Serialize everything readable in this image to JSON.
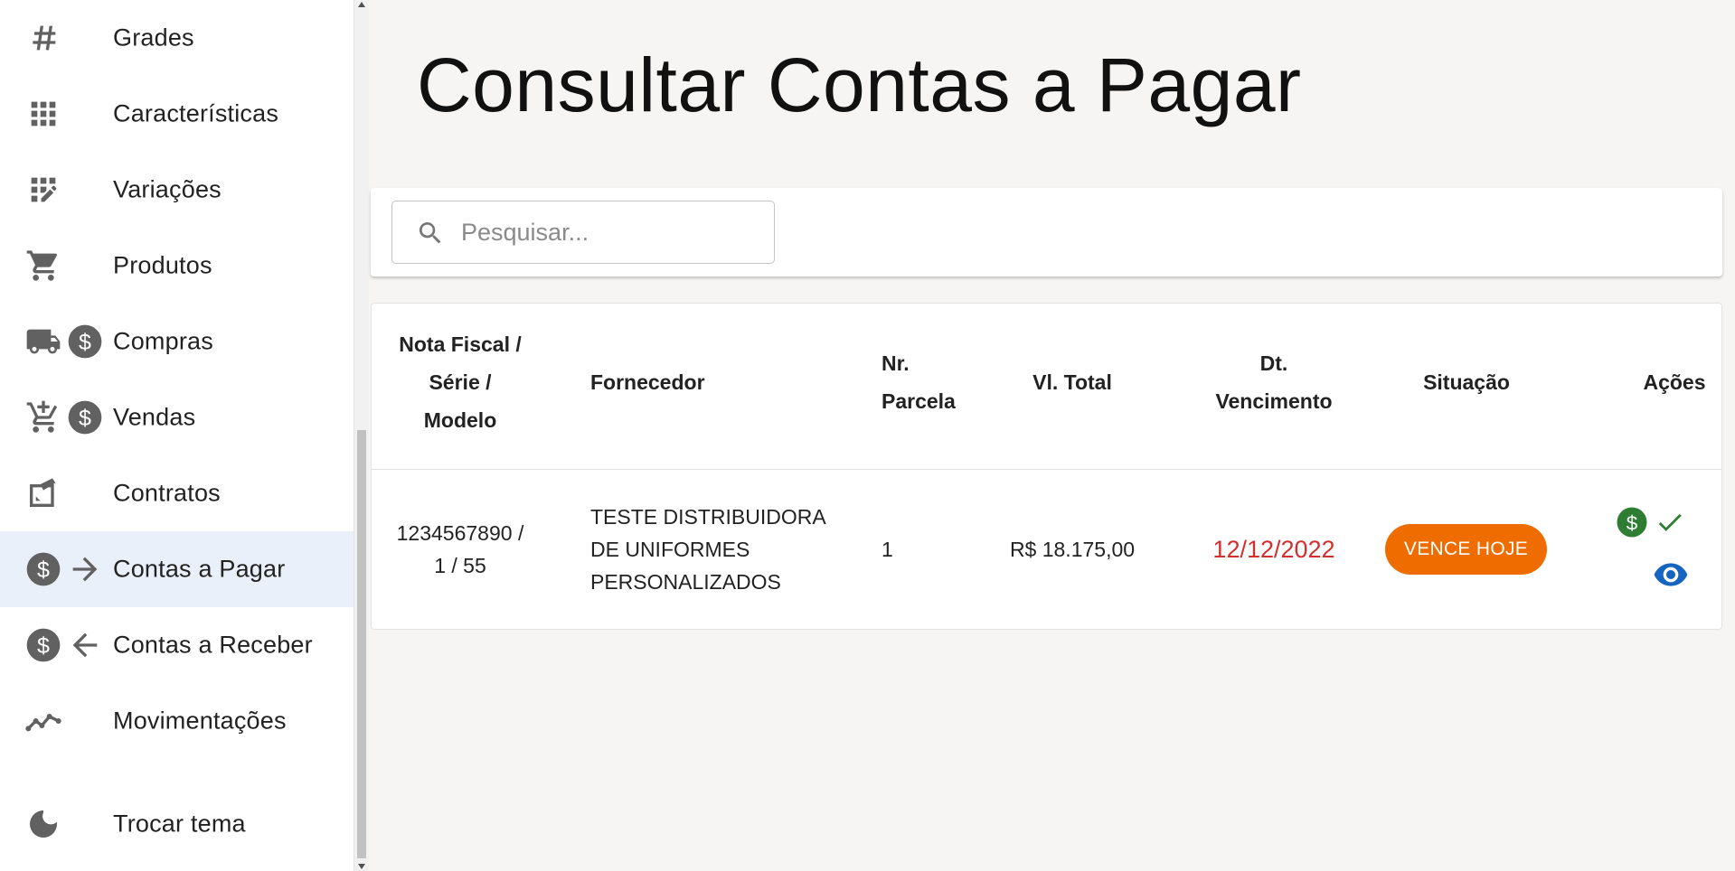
{
  "sidebar": {
    "items": [
      {
        "label": "Grades",
        "icon": "hash-icon"
      },
      {
        "label": "Características",
        "icon": "grid-icon"
      },
      {
        "label": "Variações",
        "icon": "grid-edit-icon"
      },
      {
        "label": "Produtos",
        "icon": "cart-icon"
      },
      {
        "label": "Compras",
        "icon": "truck-dollar-icon"
      },
      {
        "label": "Vendas",
        "icon": "cart-plus-dollar-icon"
      },
      {
        "label": "Contratos",
        "icon": "contract-icon"
      },
      {
        "label": "Contas a Pagar",
        "icon": "dollar-arrow-right-icon",
        "active": true
      },
      {
        "label": "Contas a Receber",
        "icon": "dollar-arrow-left-icon"
      },
      {
        "label": "Movimentações",
        "icon": "trend-line-icon"
      }
    ],
    "theme_toggle": {
      "label": "Trocar tema",
      "icon": "moon-icon"
    }
  },
  "main": {
    "title": "Consultar Contas a Pagar",
    "search": {
      "placeholder": "Pesquisar...",
      "value": ""
    },
    "table": {
      "headers": {
        "nota_fiscal": [
          "Nota Fiscal /",
          "Série /",
          "Modelo"
        ],
        "fornecedor": "Fornecedor",
        "parcela": [
          "Nr.",
          "Parcela"
        ],
        "valor_total": "Vl. Total",
        "vencimento": [
          "Dt.",
          "Vencimento"
        ],
        "situacao": "Situação",
        "acoes": "Ações"
      },
      "rows": [
        {
          "nota_fiscal": [
            "1234567890 /",
            "1 / 55"
          ],
          "fornecedor": [
            "TESTE DISTRIBUIDORA",
            "DE UNIFORMES",
            "PERSONALIZADOS"
          ],
          "parcela": "1",
          "valor_total": "R$ 18.175,00",
          "vencimento": "12/12/2022",
          "situacao": "VENCE HOJE"
        }
      ]
    }
  },
  "colors": {
    "accent_active_bg": "#e9f0f9",
    "status_orange": "#ef6c00",
    "due_date_red": "#d32f2f",
    "pay_green": "#2e7d32",
    "view_blue": "#1565c0",
    "icon_gray": "#616161"
  }
}
